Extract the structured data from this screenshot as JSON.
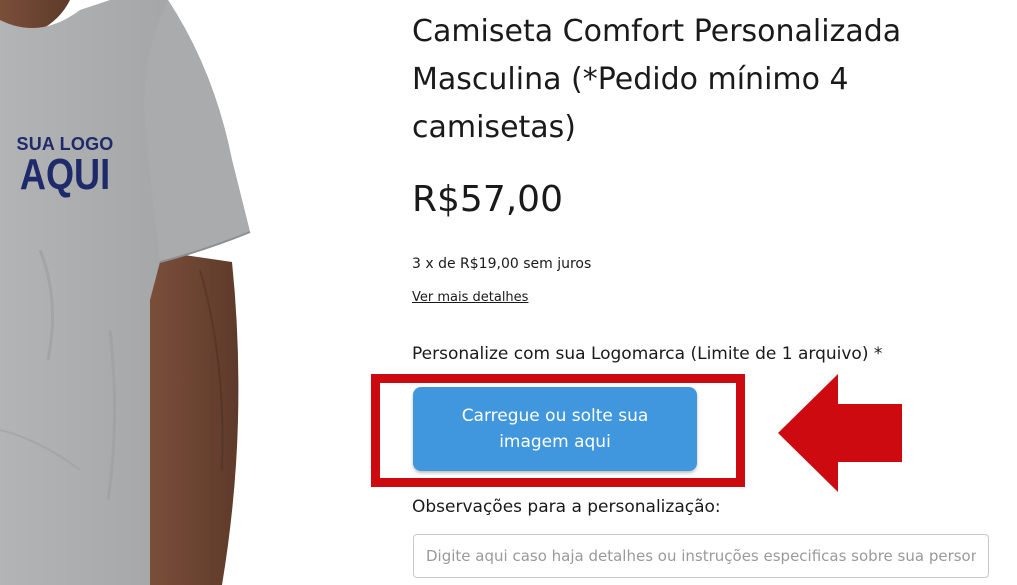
{
  "product": {
    "title": "Camiseta Comfort Personalizada Masculina (*Pedido mínimo 4 camisetas)",
    "price": "R$57,00",
    "installments": "3 x de R$19,00 sem juros",
    "details_link": "Ver mais detalhes",
    "image": {
      "print_line1": "SUA LOGO",
      "print_line2": "AQUI"
    }
  },
  "upload": {
    "label": "Personalize com sua Logomarca (Limite de 1 arquivo) *",
    "button_label": "Carregue ou solte sua imagem aqui"
  },
  "notes": {
    "label": "Observações para a personalização:",
    "placeholder": "Digite aqui caso haja detalhes ou instruções especificas sobre sua personalização",
    "value": ""
  },
  "annotation": {
    "highlight_color": "#cc0a10",
    "arrow_direction": "left"
  },
  "colors": {
    "button": "#4097de",
    "shirt": "#a7a9aa",
    "print": "#1f2a6b"
  },
  "icons": [
    "red-arrow-pointer-icon"
  ]
}
